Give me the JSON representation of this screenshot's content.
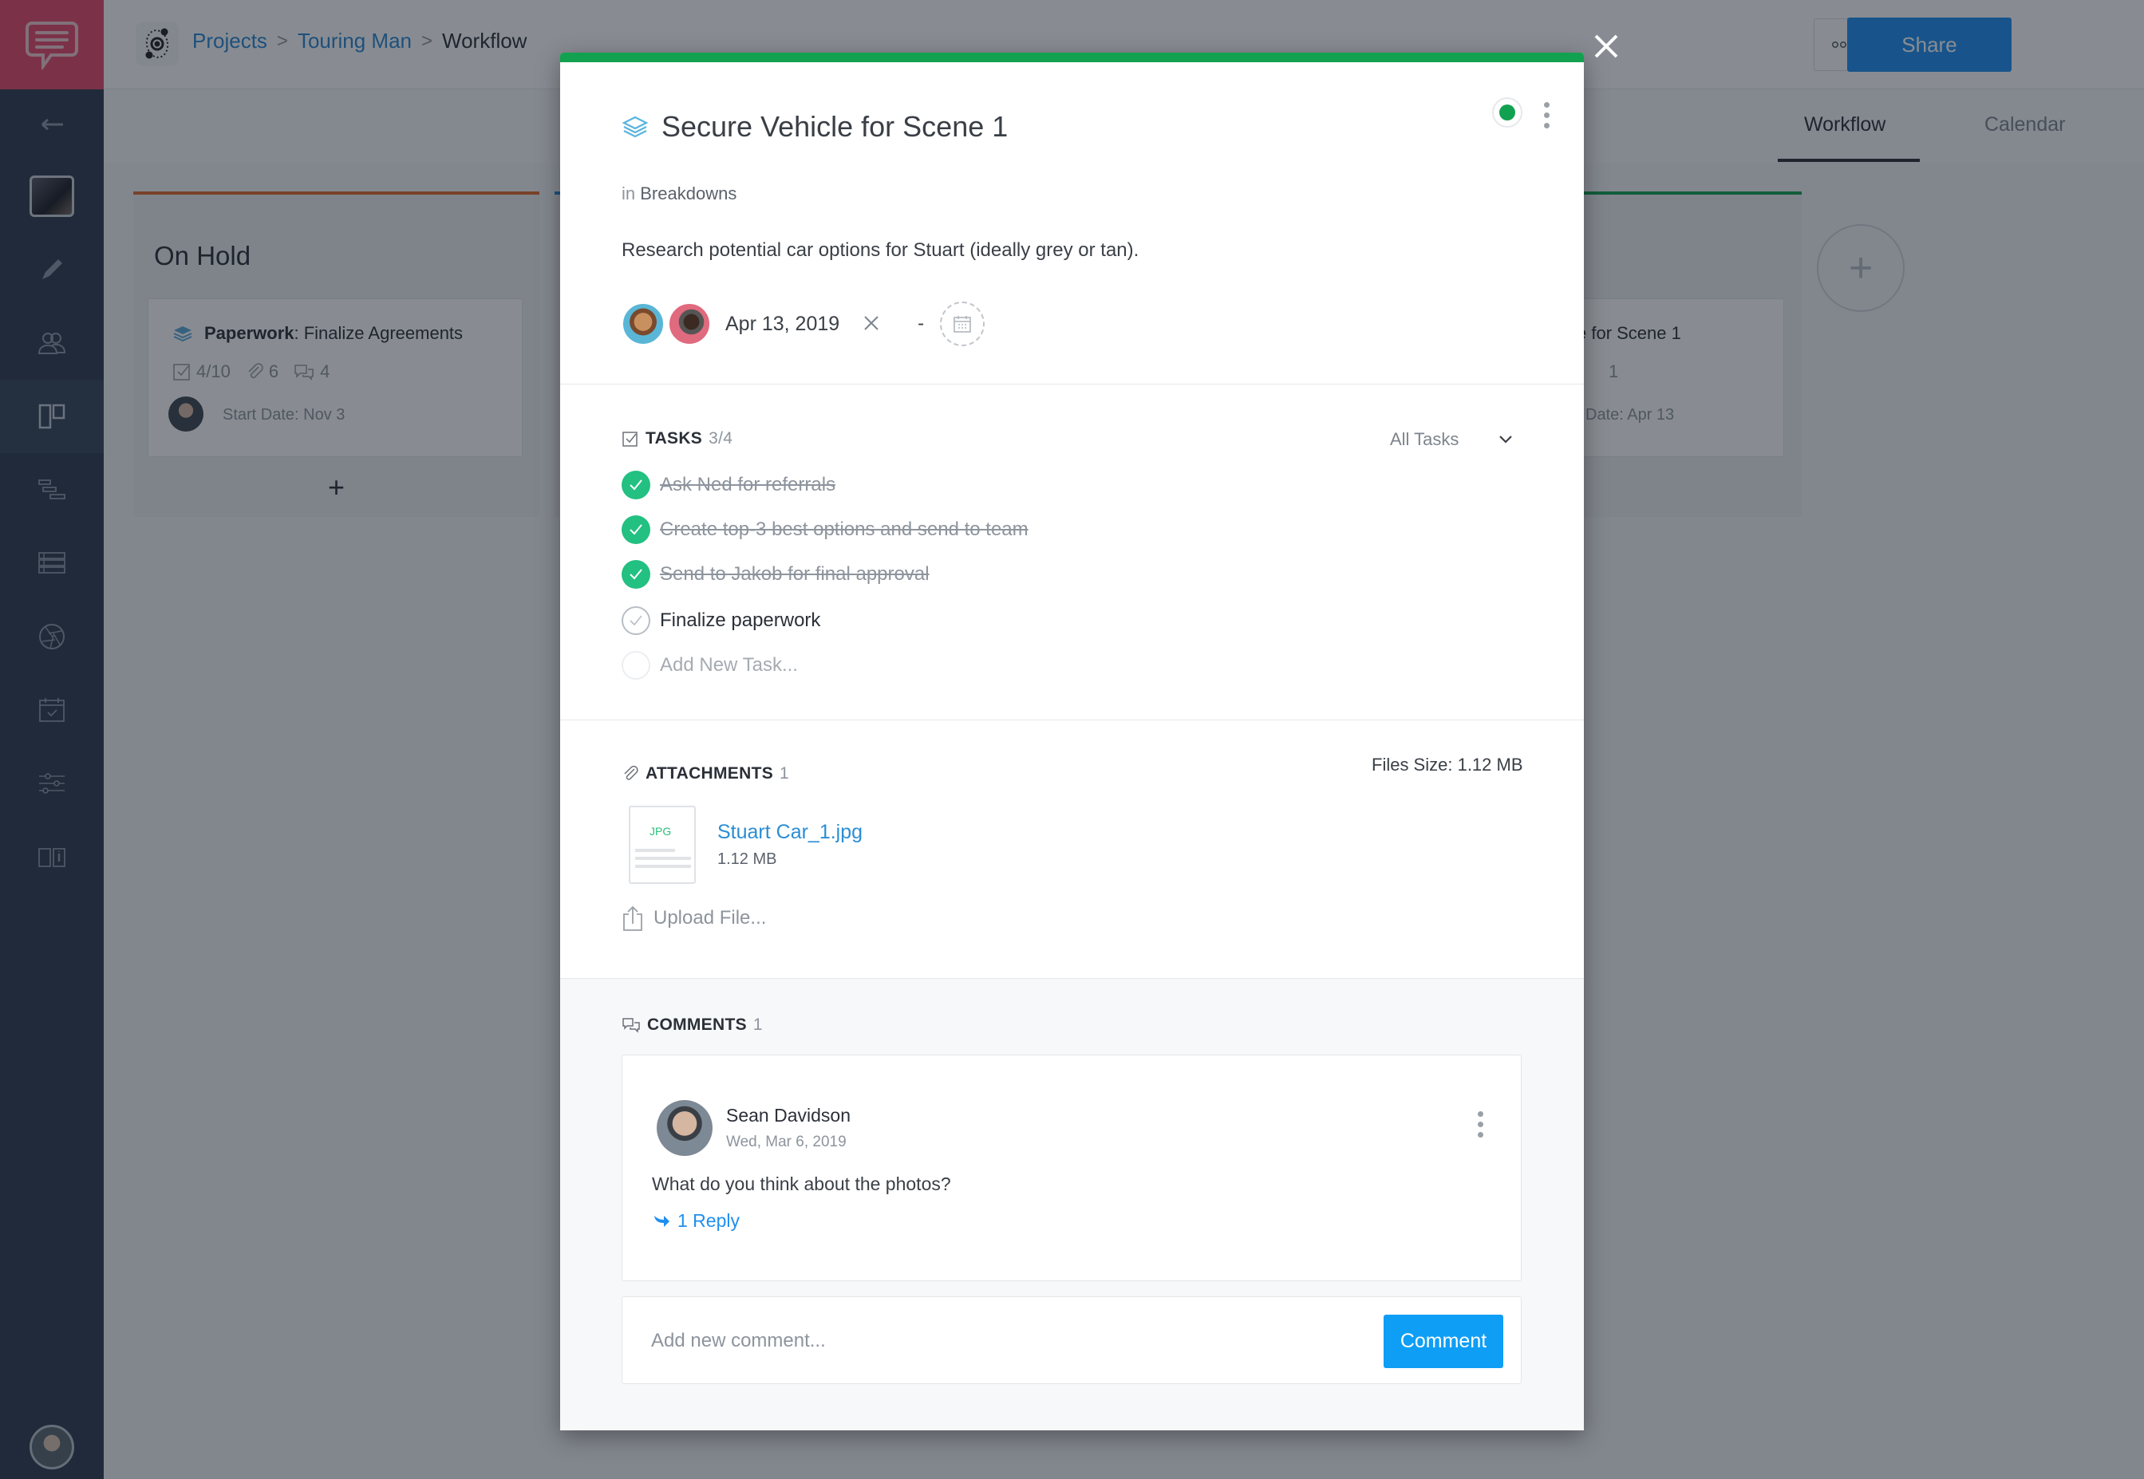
{
  "header": {
    "breadcrumb": [
      {
        "label": "Projects",
        "link": true
      },
      {
        "label": "Touring Man",
        "link": true
      },
      {
        "label": "Workflow",
        "link": false
      }
    ],
    "more_icon": "more-horizontal-icon",
    "archive_icon": "archive-box-icon",
    "share_label": "Share"
  },
  "view_tabs": [
    {
      "label": "Workflow",
      "active": true
    },
    {
      "label": "Calendar",
      "active": false
    }
  ],
  "sidebar": {
    "items": [
      {
        "icon": "back-arrow-icon"
      },
      {
        "icon": "project-thumbnail"
      },
      {
        "icon": "pencil-icon"
      },
      {
        "icon": "team-icon"
      },
      {
        "icon": "board-icon",
        "active": true
      },
      {
        "icon": "timeline-icon"
      },
      {
        "icon": "list-icon"
      },
      {
        "icon": "aperture-icon"
      },
      {
        "icon": "calendar-check-icon"
      },
      {
        "icon": "sliders-icon"
      },
      {
        "icon": "book-icon"
      }
    ]
  },
  "board": {
    "columns": [
      {
        "title": "On Hold",
        "color": "#e06a2c",
        "cards": [
          {
            "category": "Paperwork",
            "title": ": Finalize Agreements",
            "tasks": "4/10",
            "attachments": "6",
            "comments": "4",
            "start_date": "Start Date: Nov 3"
          }
        ]
      },
      {
        "title": "",
        "color": "#2a86d1",
        "cards": []
      },
      {
        "title": "",
        "color": "#12a150",
        "cards": [
          {
            "title_partial": "e for Scene 1",
            "count_partial": "1",
            "start_date_partial": "Date: Apr 13"
          }
        ]
      }
    ],
    "add_card_symbol": "+",
    "add_column_symbol": "+"
  },
  "modal": {
    "accent_color": "#12a150",
    "title": "Secure Vehicle for Scene 1",
    "in_prefix": "in",
    "in_location": "Breakdowns",
    "description": "Research potential car options for Stuart (ideally grey or tan).",
    "date": "Apr 13, 2019",
    "date_separator": "-",
    "tasks": {
      "heading": "TASKS",
      "count": "3/4",
      "filter": "All Tasks",
      "items": [
        {
          "label": "Ask Ned for referrals",
          "done": true
        },
        {
          "label": "Create top-3 best options and send to team",
          "done": true
        },
        {
          "label": "Send to Jakob for final approval",
          "done": true
        },
        {
          "label": "Finalize paperwork",
          "done": false
        }
      ],
      "new_task_placeholder": "Add New Task..."
    },
    "attachments": {
      "heading": "ATTACHMENTS",
      "count": "1",
      "files_size": "Files Size: 1.12 MB",
      "files": [
        {
          "ext": "JPG",
          "name": "Stuart Car_1.jpg",
          "size": "1.12 MB"
        }
      ],
      "upload_label": "Upload File..."
    },
    "comments": {
      "heading": "COMMENTS",
      "count": "1",
      "items": [
        {
          "author": "Sean Davidson",
          "date": "Wed, Mar 6, 2019",
          "body": "What do you think about the photos?",
          "replies": "1 Reply"
        }
      ],
      "input_placeholder": "Add new comment...",
      "submit_label": "Comment"
    }
  }
}
